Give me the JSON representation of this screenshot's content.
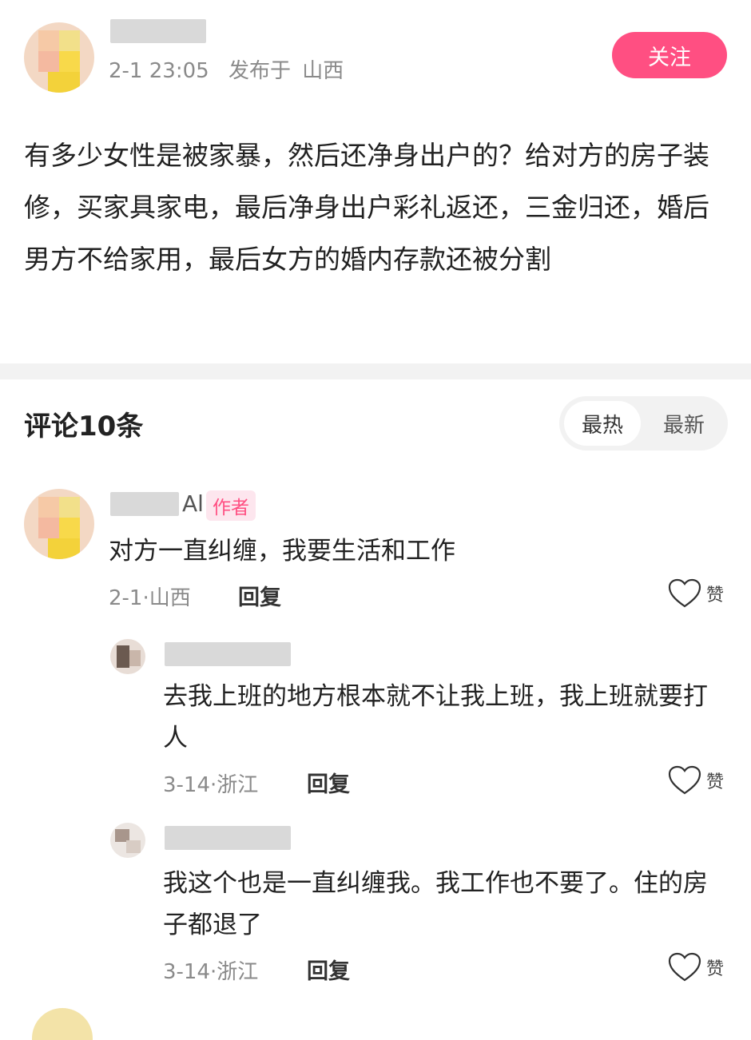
{
  "post": {
    "time": "2-1 23:05",
    "location_prefix": "发布于",
    "location": "山西",
    "follow_label": "关注",
    "body": "有多少女性是被家暴，然后还净身出户的？给对方的房子装修，买家具家电，最后净身出户彩礼返还，三金归还，婚后男方不给家用，最后女方的婚内存款还被分割"
  },
  "comments_header": {
    "title": "评论10条",
    "sort_hot": "最热",
    "sort_new": "最新"
  },
  "comments": [
    {
      "name_suffix": "Al",
      "badge": "作者",
      "text": "对方一直纠缠，我要生活和工作",
      "meta": "2-1·山西",
      "reply_label": "回复",
      "like_label": "赞"
    },
    {
      "text": "去我上班的地方根本就不让我上班，我上班就要打人",
      "meta": "3-14·浙江",
      "reply_label": "回复",
      "like_label": "赞"
    },
    {
      "text": "我这个也是一直纠缠我。我工作也不要了。住的房子都退了",
      "meta": "3-14·浙江",
      "reply_label": "回复",
      "like_label": "赞"
    }
  ],
  "colors": {
    "accent": "#ff4f82",
    "muted_text": "#8a8a8a",
    "divider": "#f2f2f2"
  },
  "icons": {
    "like": "heart-outline-icon"
  }
}
